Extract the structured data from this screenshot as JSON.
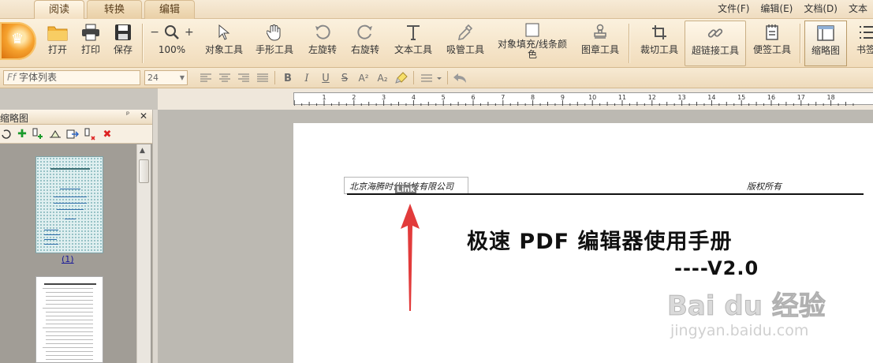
{
  "tabs": [
    {
      "label": "阅读",
      "active": true
    },
    {
      "label": "转换",
      "active": false
    },
    {
      "label": "编辑",
      "active": false
    }
  ],
  "menu": [
    "文件(F)",
    "编辑(E)",
    "文档(D)",
    "文本"
  ],
  "ribbon": {
    "open": "打开",
    "print": "打印",
    "save": "保存",
    "zoom_minus": "−",
    "zoom_plus": "+",
    "zoom_value": "100%",
    "object_tool": "对象工具",
    "hand_tool": "手形工具",
    "rotate_left": "左旋转",
    "rotate_right": "右旋转",
    "text_tool": "文本工具",
    "eyedropper_tool": "吸管工具",
    "object_fill": "对象填充/线条颜色",
    "stamp_tool": "图章工具",
    "crop_tool": "裁切工具",
    "hyperlink_tool": "超链接工具",
    "note_tool": "便签工具",
    "thumbnails": "缩略图",
    "bookmarks": "书签"
  },
  "format": {
    "font_icon": "Ff",
    "font_list": "字体列表",
    "font_size": "24",
    "bold": "B",
    "italic": "I",
    "underline": "U",
    "strike": "S",
    "superscript": "A²",
    "subscript": "A₂"
  },
  "panel": {
    "title": "缩略图",
    "pin": "📌",
    "close": "✕",
    "page1_label": "(1)"
  },
  "ruler_ticks": [
    "1",
    "2",
    "3",
    "4",
    "5",
    "6",
    "7",
    "8",
    "9",
    "10",
    "11",
    "12",
    "13",
    "14",
    "15",
    "16",
    "17",
    "18"
  ],
  "document": {
    "header_left": "北京海腾时代科技有限公司",
    "header_right": "版权所有",
    "link_tag": "Link",
    "title": "极速 PDF 编辑器使用手册",
    "version": "----V2.0"
  },
  "watermark": {
    "main": "Bai du 经验",
    "sub": "jingyan.baidu.com"
  },
  "colors": {
    "accent_arrow": "#e23b3b",
    "ribbon_bg": "#f1dcbb",
    "link_tag_bg": "#7a7a7a"
  }
}
